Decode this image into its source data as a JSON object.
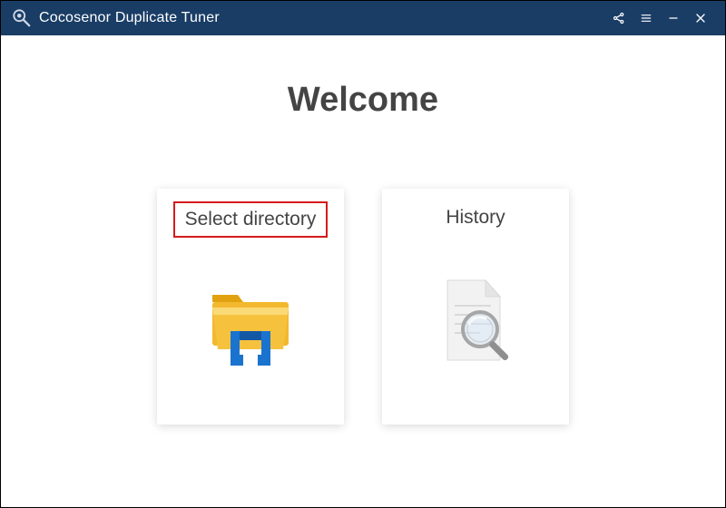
{
  "titlebar": {
    "app_title": "Cocosenor Duplicate Tuner"
  },
  "main": {
    "welcome_heading": "Welcome",
    "cards": {
      "select_directory": {
        "label": "Select directory",
        "highlighted": true
      },
      "history": {
        "label": "History",
        "highlighted": false
      }
    }
  },
  "colors": {
    "titlebar_bg": "#1a3d66",
    "highlight_border": "#d61a1a",
    "folder_yellow": "#f6c23e",
    "folder_tab": "#e2a210",
    "folder_blue": "#1b73d0",
    "doc_grey": "#e7e7e7",
    "magnifier_grey": "#a6a6a6"
  }
}
